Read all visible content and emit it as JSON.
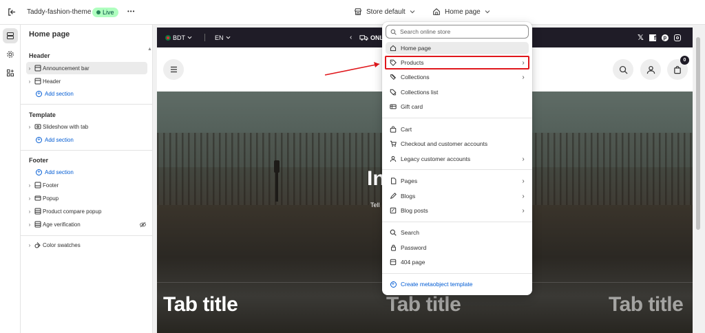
{
  "topbar": {
    "theme_name": "Taddy-fashion-theme",
    "live_label": "Live",
    "more_glyph": "•••",
    "store_selector": "Store default",
    "page_selector": "Home page"
  },
  "panel": {
    "title": "Home page",
    "header_group": {
      "title": "Header",
      "items": [
        "Announcement bar",
        "Header"
      ],
      "add_label": "Add section"
    },
    "template_group": {
      "title": "Template",
      "items": [
        "Slideshow with tab"
      ],
      "add_label": "Add section"
    },
    "footer_group": {
      "title": "Footer",
      "add_label": "Add section",
      "items": [
        "Footer",
        "Popup",
        "Product compare popup",
        "Age verification"
      ]
    },
    "color_swatches": "Color swatches"
  },
  "preview": {
    "currency": "BDT",
    "language": "EN",
    "announcement": "ONL",
    "cart_count": "0",
    "hero_title": "In",
    "hero_sub": "Tell",
    "tab_titles": [
      "Tab title",
      "Tab title",
      "Tab title"
    ]
  },
  "dropdown": {
    "search_placeholder": "Search online store",
    "groups": [
      [
        "Home page",
        "Products",
        "Collections",
        "Collections list",
        "Gift card"
      ],
      [
        "Cart",
        "Checkout and customer accounts",
        "Legacy customer accounts"
      ],
      [
        "Pages",
        "Blogs",
        "Blog posts"
      ],
      [
        "Search",
        "Password",
        "404 page"
      ],
      [
        "Create metaobject template"
      ]
    ]
  },
  "colors": {
    "accent_blue": "#005bd3",
    "live_green": "#affebf",
    "highlight_red": "#e0161b",
    "announcement_bg": "#1f1c27"
  }
}
